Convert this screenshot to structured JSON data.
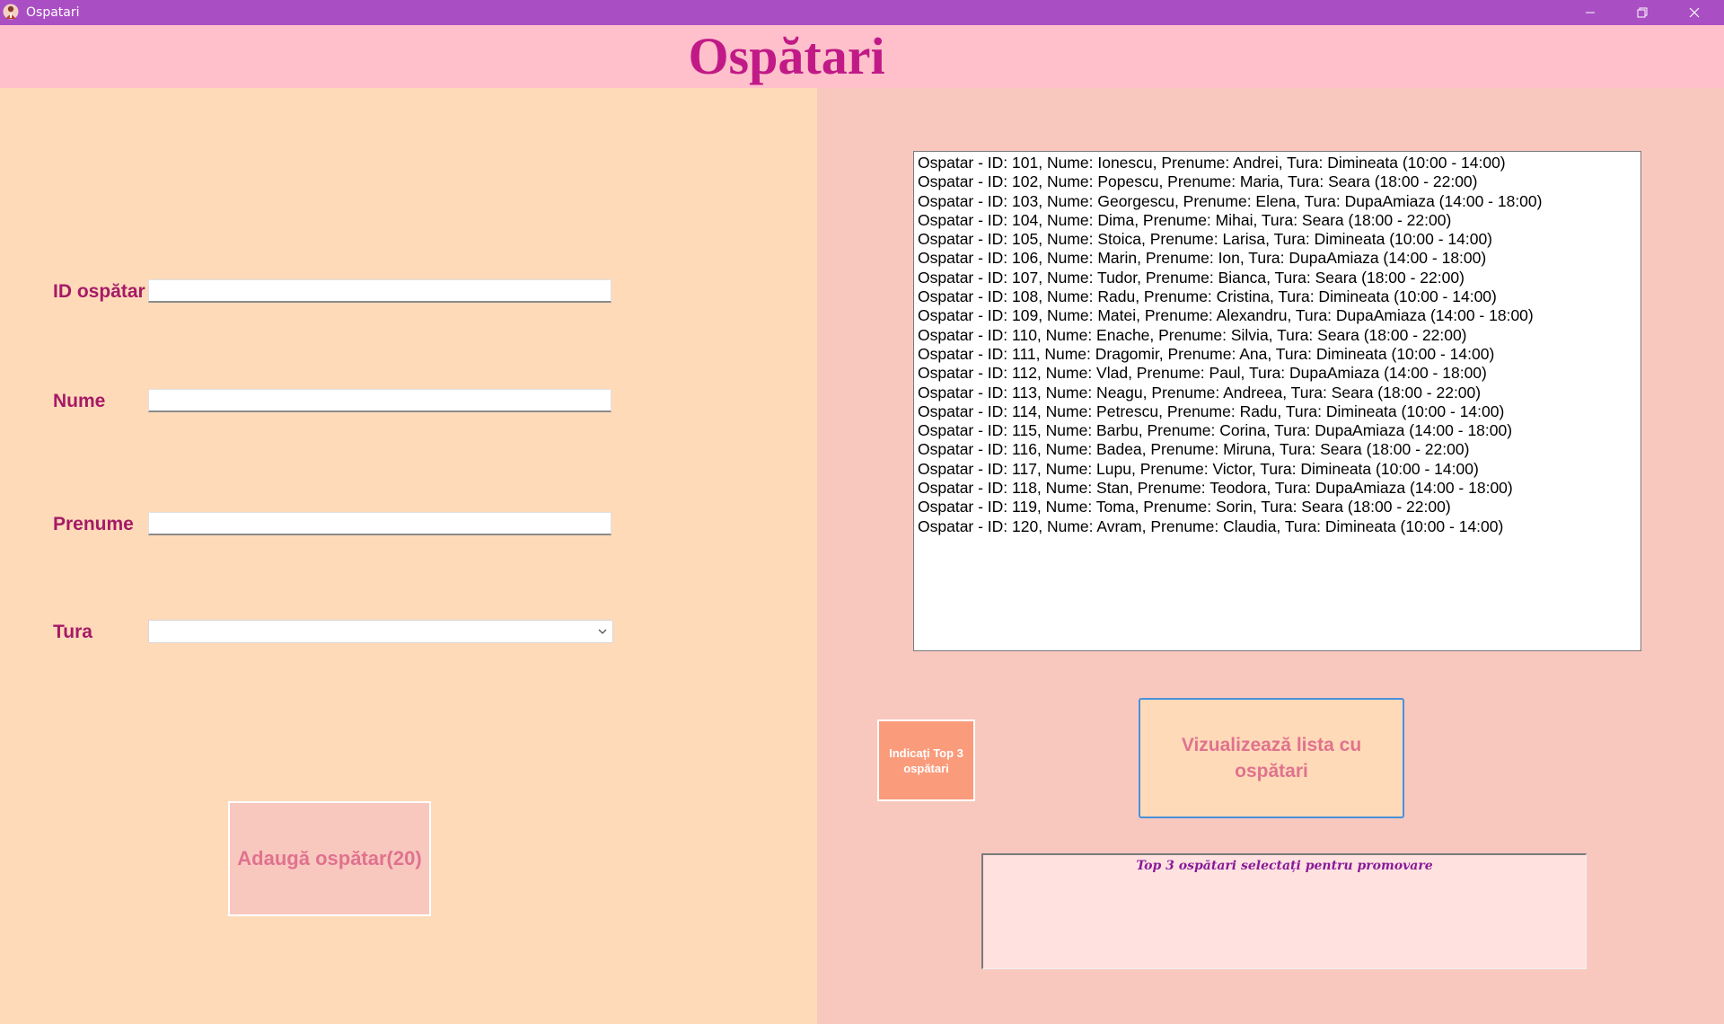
{
  "window": {
    "title": "Ospatari",
    "icon": "app-waiter-icon"
  },
  "header": {
    "title": "Ospătari"
  },
  "form": {
    "id_label": "ID ospătar",
    "id_value": "",
    "nume_label": "Nume",
    "nume_value": "",
    "prenume_label": "Prenume",
    "prenume_value": "",
    "tura_label": "Tura",
    "tura_value": "",
    "add_button": "Adaugă ospătar(20)"
  },
  "list": {
    "items": [
      "Ospatar - ID: 101, Nume: Ionescu, Prenume: Andrei, Tura: Dimineata (10:00 - 14:00)",
      "Ospatar - ID: 102, Nume: Popescu, Prenume: Maria, Tura: Seara (18:00 - 22:00)",
      "Ospatar - ID: 103, Nume: Georgescu, Prenume: Elena, Tura: DupaAmiaza (14:00 - 18:00)",
      "Ospatar - ID: 104, Nume: Dima, Prenume: Mihai, Tura: Seara (18:00 - 22:00)",
      "Ospatar - ID: 105, Nume: Stoica, Prenume: Larisa, Tura: Dimineata (10:00 - 14:00)",
      "Ospatar - ID: 106, Nume: Marin, Prenume: Ion, Tura: DupaAmiaza (14:00 - 18:00)",
      "Ospatar - ID: 107, Nume: Tudor, Prenume: Bianca, Tura: Seara (18:00 - 22:00)",
      "Ospatar - ID: 108, Nume: Radu, Prenume: Cristina, Tura: Dimineata (10:00 - 14:00)",
      "Ospatar - ID: 109, Nume: Matei, Prenume: Alexandru, Tura: DupaAmiaza (14:00 - 18:00)",
      "Ospatar - ID: 110, Nume: Enache, Prenume: Silvia, Tura: Seara (18:00 - 22:00)",
      "Ospatar - ID: 111, Nume: Dragomir, Prenume: Ana, Tura: Dimineata (10:00 - 14:00)",
      "Ospatar - ID: 112, Nume: Vlad, Prenume: Paul, Tura: DupaAmiaza (14:00 - 18:00)",
      "Ospatar - ID: 113, Nume: Neagu, Prenume: Andreea, Tura: Seara (18:00 - 22:00)",
      "Ospatar - ID: 114, Nume: Petrescu, Prenume: Radu, Tura: Dimineata (10:00 - 14:00)",
      "Ospatar - ID: 115, Nume: Barbu, Prenume: Corina, Tura: DupaAmiaza (14:00 - 18:00)",
      "Ospatar - ID: 116, Nume: Badea, Prenume: Miruna, Tura: Seara (18:00 - 22:00)",
      "Ospatar - ID: 117, Nume: Lupu, Prenume: Victor, Tura: Dimineata (10:00 - 14:00)",
      "Ospatar - ID: 118, Nume: Stan, Prenume: Teodora, Tura: DupaAmiaza (14:00 - 18:00)",
      "Ospatar - ID: 119, Nume: Toma, Prenume: Sorin, Tura: Seara (18:00 - 22:00)",
      "Ospatar - ID: 120, Nume: Avram, Prenume: Claudia, Tura: Dimineata (10:00 - 14:00)"
    ]
  },
  "actions": {
    "top3_button": "Indicați Top 3 ospătari",
    "view_button": "Vizualizează lista cu ospătari"
  },
  "promo": {
    "title": "Top 3 ospătari selectați pentru promovare"
  },
  "colors": {
    "titlebar": "#a94fc3",
    "header": "#ffc0cb",
    "left_panel": "#ffdab9",
    "right_panel": "#f8c8bf",
    "title_text": "#c11a87",
    "label_text": "#a51a66",
    "button_text": "#e0728e",
    "top3_button": "#fa9c7c"
  }
}
